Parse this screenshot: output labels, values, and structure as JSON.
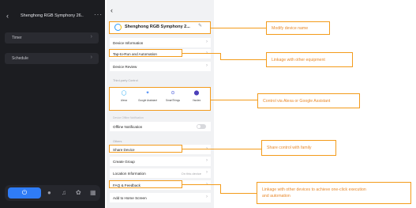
{
  "left_phone": {
    "title": "Shenghong RGB Symphony 26..",
    "back_icon": "chevron-left-icon",
    "more_icon": "more-dots-icon",
    "rows": [
      {
        "label": "Timer"
      },
      {
        "label": "Schedule"
      }
    ],
    "tabbar": {
      "power_icon": "power-icon",
      "icons": [
        "palette-icon",
        "music-icon",
        "scene-icon",
        "grid-icon"
      ]
    }
  },
  "right_phone": {
    "device_name": "Shenghong RGB Symphony 2...",
    "device_icon": "device-ring-icon",
    "edit_icon": "pencil-icon",
    "items": {
      "device_information": "Device Information",
      "tap_to_run": "Tap-to-Run and Automation",
      "device_review": "Device Review"
    },
    "third_party": {
      "section_label": "Third-party Control",
      "services": [
        {
          "label": "Alexa",
          "icon": "alexa-icon",
          "color": "#1fa8f5"
        },
        {
          "label": "Google Assistant",
          "icon": "google-assistant-icon",
          "color": "#4285f4"
        },
        {
          "label": "SmartThings",
          "icon": "smartthings-icon",
          "color": "#3c4fd8"
        },
        {
          "label": "Yandex",
          "icon": "yandex-icon",
          "color": "#4b3fb9"
        }
      ]
    },
    "offline": {
      "section_label": "Device Offline Notification",
      "label": "Offline Notification",
      "toggle_on": false
    },
    "others_label": "Others",
    "share_device": "Share Device",
    "create_group": "Create Group",
    "location": {
      "label": "Location Information",
      "value": "On this device"
    },
    "faq": "FAQ & Feedback",
    "add_home": "Add to Home Screen"
  },
  "callouts": {
    "modify_name": "Modify device name",
    "linkage_equipment": "Linkage with other equipment",
    "control_alexa": "Control via Alexa or Google Assistant",
    "share_family": "Share control with family",
    "linkage_one_click_1": "Linkage with other devices to achieve one-click execution",
    "linkage_one_click_2": "and automation"
  },
  "colors": {
    "accent": "#f39b1b",
    "callout_text": "#e8892b",
    "power_button": "#2f7cf6",
    "dark_bg": "#1c1d21",
    "light_bg": "#f1f2f4"
  }
}
